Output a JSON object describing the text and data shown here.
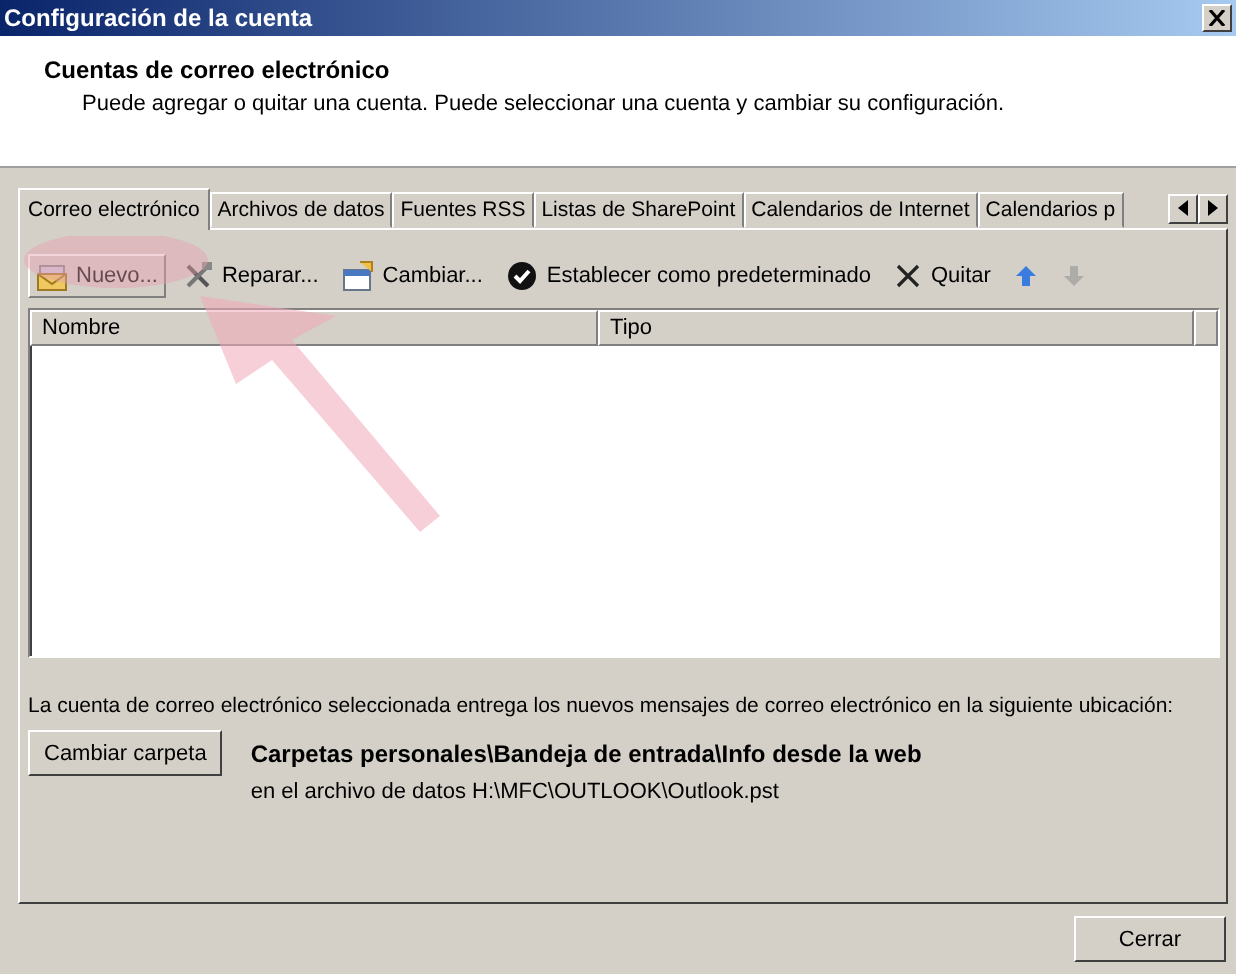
{
  "window": {
    "title": "Configuración de la cuenta"
  },
  "header": {
    "title": "Cuentas de correo electrónico",
    "subtitle": "Puede agregar o quitar una cuenta. Puede seleccionar una cuenta y cambiar su configuración."
  },
  "tabs": [
    {
      "label": "Correo electrónico",
      "selected": true
    },
    {
      "label": "Archivos de datos",
      "selected": false
    },
    {
      "label": "Fuentes RSS",
      "selected": false
    },
    {
      "label": "Listas de SharePoint",
      "selected": false
    },
    {
      "label": "Calendarios de Internet",
      "selected": false
    },
    {
      "label": "Calendarios p",
      "selected": false
    }
  ],
  "toolbar": [
    {
      "label": "Nuevo...",
      "highlighted": true,
      "disabled": false
    },
    {
      "label": "Reparar...",
      "highlighted": false,
      "disabled": false
    },
    {
      "label": "Cambiar...",
      "highlighted": false,
      "disabled": false
    },
    {
      "label": "Establecer como predeterminado",
      "highlighted": false,
      "disabled": false
    },
    {
      "label": "Quitar",
      "highlighted": false,
      "disabled": false
    },
    {
      "highlighted": false,
      "disabled": false
    },
    {
      "highlighted": false,
      "disabled": true
    }
  ],
  "table": {
    "columns": [
      "Nombre",
      "Tipo"
    ]
  },
  "delivery": {
    "description": "La cuenta de correo electrónico seleccionada entrega los nuevos mensajes de correo electrónico en la siguiente ubicación:",
    "button": "Cambiar carpeta",
    "folder": "Carpetas personales\\Bandeja de entrada\\Info desde la web",
    "file": "en el archivo de datos H:\\MFC\\OUTLOOK\\Outlook.pst"
  },
  "buttons": [
    "Cerrar"
  ]
}
